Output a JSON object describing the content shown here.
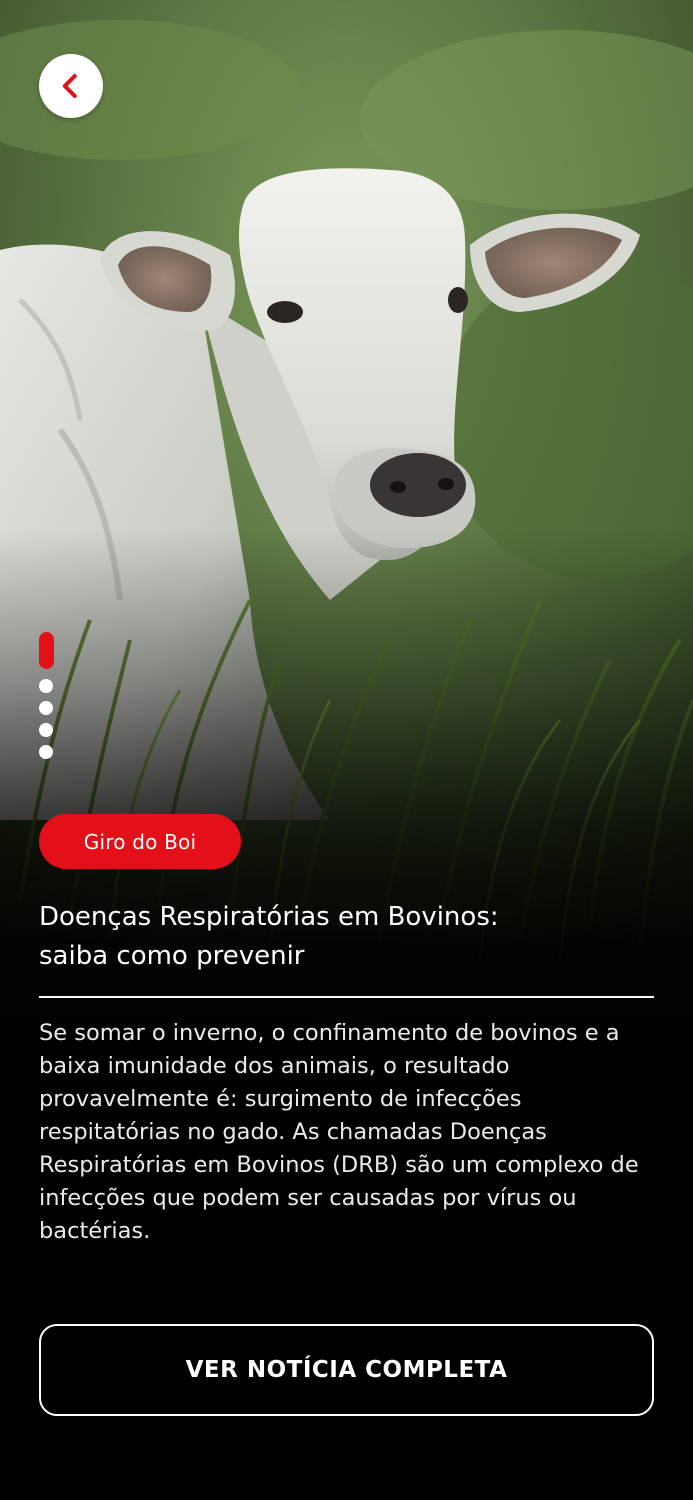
{
  "navigation": {
    "back_icon": "chevron-left-icon",
    "accent_color": "#e3101a"
  },
  "hero": {
    "image_subject": "white cow in tall grass"
  },
  "pager": {
    "total": 5,
    "active_index": 0
  },
  "article": {
    "category": "Giro do Boi",
    "title_line1": "Doenças Respiratórias em Bovinos:",
    "title_line2": "saiba como prevenir",
    "body": "Se somar o inverno, o confinamento de bovinos e a baixa imunidade dos animais, o resultado provavelmente é: surgimento de infecções respitatórias no gado. As chamadas Doenças Respiratórias em Bovinos (DRB) são um complexo de infecções que podem ser causadas por vírus ou bactérias."
  },
  "cta": {
    "label": "VER NOTÍCIA COMPLETA"
  }
}
